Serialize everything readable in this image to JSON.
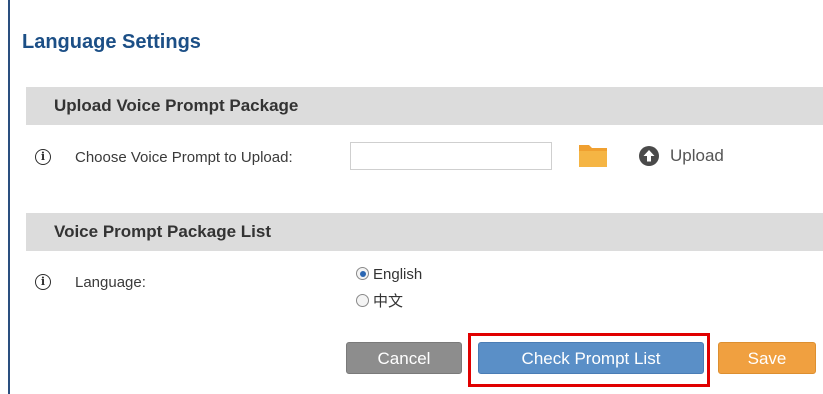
{
  "page": {
    "title": "Language Settings"
  },
  "upload_section": {
    "header": "Upload Voice Prompt Package",
    "field_label": "Choose Voice Prompt to Upload:",
    "file_value": "",
    "upload_label": "Upload"
  },
  "list_section": {
    "header": "Voice Prompt Package List",
    "field_label": "Language:",
    "options": [
      {
        "label": "English",
        "selected": true
      },
      {
        "label": "中文",
        "selected": false
      }
    ]
  },
  "buttons": {
    "cancel": "Cancel",
    "check_prompt_list": "Check Prompt List",
    "save": "Save"
  },
  "icons": {
    "info": "info-icon",
    "folder": "folder-icon",
    "upload": "upload-arrow-icon"
  },
  "colors": {
    "title": "#1c4f86",
    "section_bg": "#dcdcdc",
    "cancel_button": "#8d8d8d",
    "check_button": "#5a8fc7",
    "save_button": "#f0a040",
    "highlight": "#e00000",
    "folder": "#f0a030"
  }
}
